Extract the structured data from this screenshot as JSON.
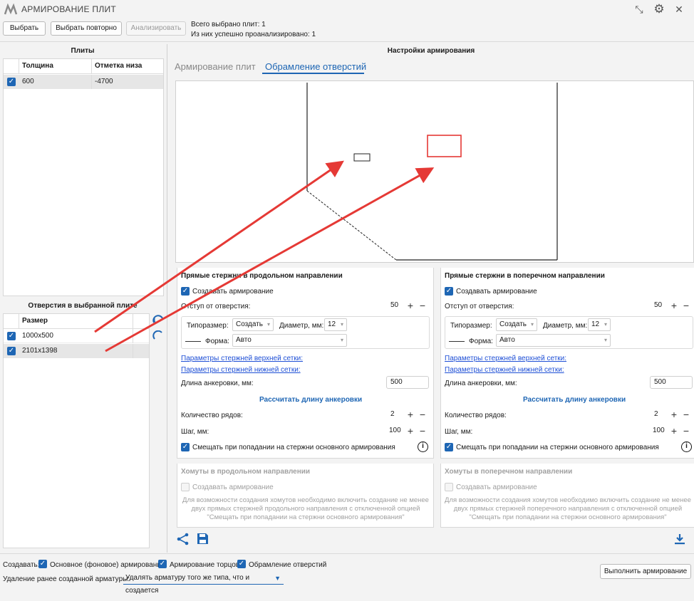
{
  "app": {
    "title": "АРМИРОВАНИЕ ПЛИТ"
  },
  "toolbar": {
    "select": "Выбрать",
    "reselect": "Выбрать повторно",
    "analyze": "Анализировать",
    "total_selected": "Всего выбрано плит: 1",
    "analyzed": "Из них успешно проанализировано: 1"
  },
  "slabs": {
    "title": "Плиты",
    "columns": [
      "Толщина",
      "Отметка низа"
    ],
    "rows": [
      {
        "thickness": "600",
        "bottom": "-4700"
      }
    ]
  },
  "openings": {
    "title": "Отверстия в выбранной плите",
    "column": "Размер",
    "rows": [
      {
        "size": "1000x500"
      },
      {
        "size": "2101x1398"
      }
    ]
  },
  "settings": {
    "title": "Настройки армирования",
    "tabs": [
      "Армирование плит",
      "Обрамление отверстий"
    ]
  },
  "longitudinal": {
    "title": "Прямые стержни в продольном направлении",
    "create": "Создавать армирование",
    "offset_label": "Отступ от отверстия:",
    "offset_value": "50",
    "type_label": "Типоразмер:",
    "type_value": "Создать",
    "diameter_label": "Диаметр, мм:",
    "diameter_value": "12",
    "shape_label": "Форма:",
    "shape_value": "Авто",
    "top_params": "Параметры стержней верхней сетки:",
    "bottom_params": "Параметры стержней нижней сетки:",
    "anchor_label": "Длина анкеровки, мм:",
    "anchor_value": "500",
    "calc_anchor": "Рассчитать длину анкеровки",
    "rows_label": "Количество рядов:",
    "rows_value": "2",
    "step_label": "Шаг, мм:",
    "step_value": "100",
    "shift": "Смещать при попадании на стержни основного армирования"
  },
  "transverse": {
    "title": "Прямые стержни в поперечном направлении",
    "create": "Создавать армирование",
    "offset_label": "Отступ от отверстия:",
    "offset_value": "50",
    "type_label": "Типоразмер:",
    "type_value": "Создать",
    "diameter_label": "Диаметр, мм:",
    "diameter_value": "12",
    "shape_label": "Форма:",
    "shape_value": "Авто",
    "top_params": "Параметры стержней верхней сетки:",
    "bottom_params": "Параметры стержней нижней сетки:",
    "anchor_label": "Длина анкеровки, мм:",
    "anchor_value": "500",
    "calc_anchor": "Рассчитать длину анкеровки",
    "rows_label": "Количество рядов:",
    "rows_value": "2",
    "step_label": "Шаг, мм:",
    "step_value": "100",
    "shift": "Смещать при попадании на стержни основного армирования"
  },
  "stirrups_long": {
    "title": "Хомуты в продольном направлении",
    "create": "Создавать армирование",
    "note": "Для возможности создания хомутов необходимо включить создание не менее двух прямых стержней продольного направления с отключенной опцией \"Смещать при попадании на стержни основного армирования\""
  },
  "stirrups_trans": {
    "title": "Хомуты в поперечном направлении",
    "create": "Создавать армирование",
    "note": "Для возможности создания хомутов необходимо включить создание не менее двух прямых стержней поперечного направления с отключенной опцией \"Смещать при попадании на стержни основного армирования\""
  },
  "footer": {
    "create_label": "Создавать:",
    "opt_main": "Основное (фоновое) армирование",
    "opt_ends": "Армирование торцов",
    "opt_openings": "Обрамление отверстий",
    "delete_label": "Удаление ранее созданной арматуры:",
    "delete_value": "Удалять арматуру того же типа, что и создается",
    "run": "Выполнить армирование"
  },
  "colors": {
    "accent": "#1e66b4",
    "annotation": "#e53935"
  }
}
